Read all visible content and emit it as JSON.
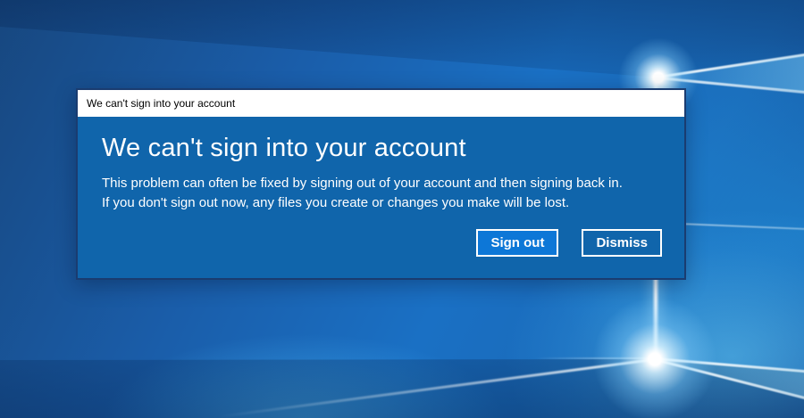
{
  "colors": {
    "dialog_body": "#1065ab",
    "dialog_border": "#1a3c70",
    "titlebar_bg": "#ffffff",
    "titlebar_text": "#000000",
    "dialog_text": "#ffffff",
    "primary_button_bg": "#0d77d7",
    "button_border": "#ffffff"
  },
  "dialog": {
    "titlebar_text": "We can't sign into your account",
    "heading": "We can't sign into your account",
    "message_line1": "This problem can often be fixed by signing out of your account and then signing back in.",
    "message_line2": "If you don't sign out now, any files you create or changes you make will be lost.",
    "buttons": [
      {
        "label": "Sign out",
        "primary": true
      },
      {
        "label": "Dismiss",
        "primary": false
      }
    ]
  }
}
